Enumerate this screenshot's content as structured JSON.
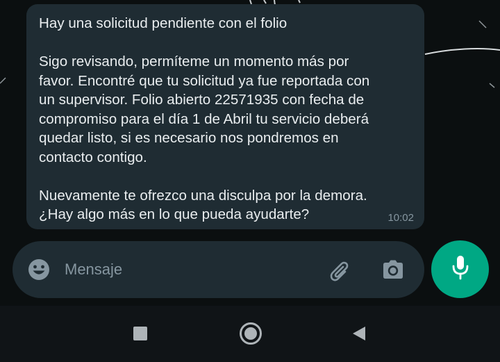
{
  "message": {
    "paragraphs": [
      "Hay una solicitud pendiente con el folio",
      "Sigo revisando, permíteme un momento más por\nfavor. Encontré que tu solicitud ya fue reportada con\nun supervisor. Folio abierto 22571935 con fecha de\ncompromiso para el día 1 de Abril tu servicio deberá\nquedar listo, si es necesario nos pondremos en\ncontacto contigo.",
      "Nuevamente te ofrezco una disculpa por la demora.\n¿Hay algo más en lo que pueda ayudarte?"
    ],
    "time": "10:02"
  },
  "composer": {
    "placeholder": "Mensaje"
  },
  "icons": {
    "emoji": "emoji-icon",
    "attach": "paperclip-icon",
    "camera": "camera-icon",
    "mic": "microphone-icon",
    "nav_recents": "recents-square-icon",
    "nav_home": "home-circle-icon",
    "nav_back": "back-triangle-icon"
  },
  "colors": {
    "bubble": "#1f2c33",
    "accent": "#00a884",
    "text": "#e9edef",
    "muted": "#8696a0"
  }
}
